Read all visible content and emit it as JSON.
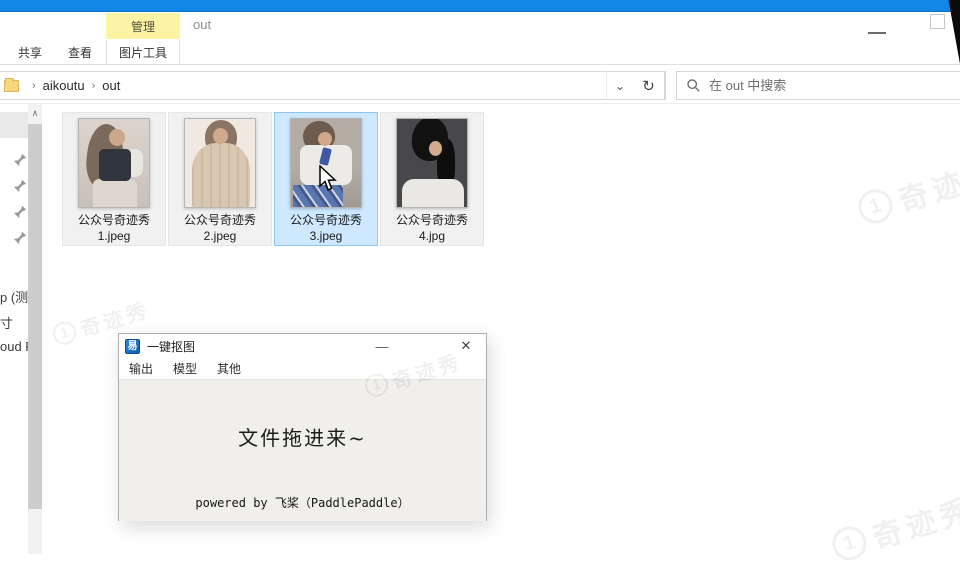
{
  "explorer": {
    "window_title": "out",
    "window_controls": {
      "minimize_glyph": "—"
    },
    "ribbon": {
      "contextual_tab": "管理",
      "tabs": [
        "共享",
        "查看",
        "图片工具"
      ]
    },
    "address_bar": {
      "breadcrumb_sep": "›",
      "crumbs": [
        "aikoutu",
        "out"
      ],
      "dropdown_glyph": "⌄",
      "refresh_glyph": "↻"
    },
    "search": {
      "placeholder": "在 out 中搜索"
    },
    "nav_pane": {
      "clipped_labels": [
        "p (测",
        "寸",
        "oud F"
      ],
      "scroll_up_glyph": "∧"
    },
    "files": [
      {
        "line1": "公众号奇迹秀",
        "line2": "1.jpeg"
      },
      {
        "line1": "公众号奇迹秀",
        "line2": "2.jpeg"
      },
      {
        "line1": "公众号奇迹秀",
        "line2": "3.jpeg"
      },
      {
        "line1": "公众号奇迹秀",
        "line2": "4.jpg"
      }
    ],
    "selected_index": 2
  },
  "dialog": {
    "icon_glyph": "易",
    "title": "一键抠图",
    "menu": [
      "输出",
      "模型",
      "其他"
    ],
    "minimize_glyph": "—",
    "close_glyph": "✕",
    "drop_hint": "文件拖进来~",
    "footer": "powered by 飞桨（PaddlePaddle）"
  },
  "watermark": {
    "logo_digit": "1",
    "text": "奇迹秀"
  },
  "colors": {
    "titlebar_blue": "#1287e8",
    "contextual_tab_yellow": "#fdf3a4",
    "selection_blue": "#cde8ff"
  }
}
